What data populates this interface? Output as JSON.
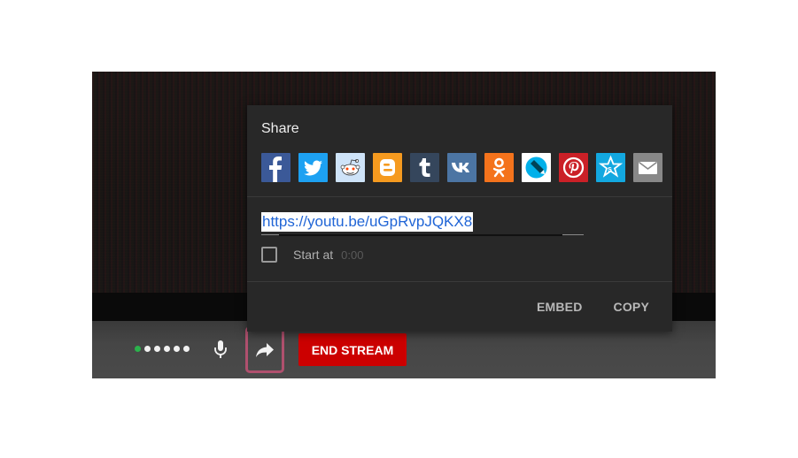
{
  "share_popup": {
    "title": "Share",
    "social_icons": [
      {
        "name": "facebook-icon",
        "color": "#3b5998"
      },
      {
        "name": "twitter-icon",
        "color": "#1da1f2"
      },
      {
        "name": "reddit-icon",
        "color": "#cee3f8"
      },
      {
        "name": "blogger-icon",
        "color": "#f59a1f"
      },
      {
        "name": "tumblr-icon",
        "color": "#35465c"
      },
      {
        "name": "vk-icon",
        "color": "#4c75a3"
      },
      {
        "name": "odnoklassniki-icon",
        "color": "#f4731c"
      },
      {
        "name": "livejournal-icon",
        "color": "#00b0ea"
      },
      {
        "name": "pinterest-icon",
        "color": "#cb2027"
      },
      {
        "name": "myspace-icon",
        "color": "#13a8e0"
      },
      {
        "name": "email-icon",
        "color": "#888888"
      }
    ],
    "url": "https://youtu.be/uGpRvpJQKX8",
    "start_at_label": "Start at",
    "start_at_time": "0:00",
    "embed_label": "EMBED",
    "copy_label": "COPY"
  },
  "controls": {
    "end_stream_label": "END STREAM",
    "share_icon": "share-arrow-icon",
    "mic_icon": "microphone-icon",
    "accent_color": "#cc0000",
    "highlight_color": "#b0506e"
  }
}
